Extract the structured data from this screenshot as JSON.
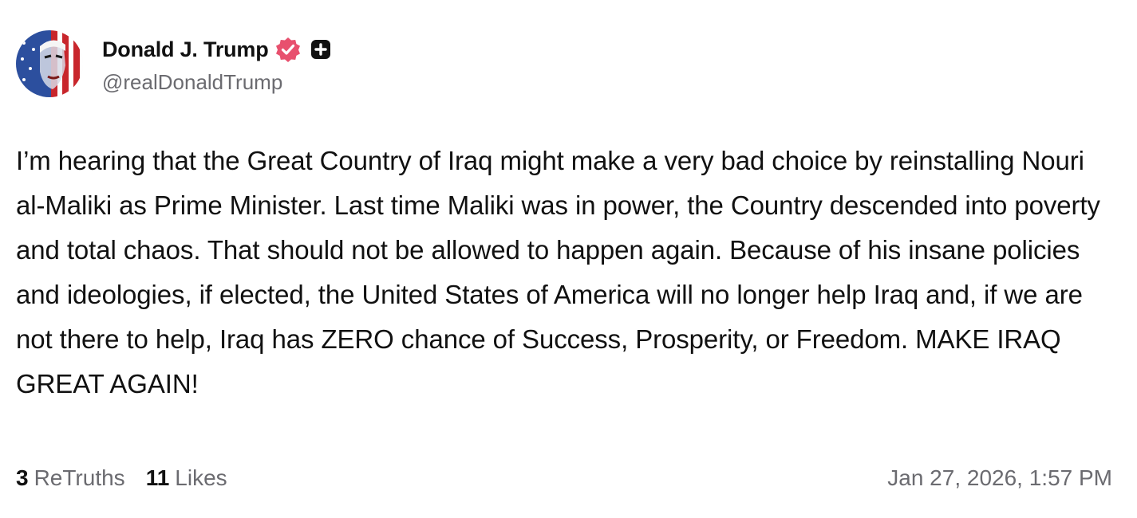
{
  "author": {
    "display_name": "Donald J. Trump",
    "handle": "@realDonaldTrump",
    "verified_icon": "verified-badge-icon",
    "plus_icon": "plus-square-icon",
    "verified_color": "#e8506e"
  },
  "post": {
    "text": "I’m hearing that the Great Country of Iraq might make a very bad choice by reinstalling Nouri al-Maliki as Prime Minister. Last time Maliki was in power, the Country descended into poverty and total chaos. That should not be allowed to happen again. Because of his insane policies and ideologies, if elected, the United States of America will no longer help Iraq and, if we are not there to help, Iraq has ZERO chance of Success, Prosperity, or Freedom. MAKE IRAQ GREAT AGAIN!"
  },
  "stats": {
    "retruths_count": "3",
    "retruths_label": "ReTruths",
    "likes_count": "11",
    "likes_label": "Likes"
  },
  "timestamp": "Jan 27, 2026, 1:57 PM"
}
